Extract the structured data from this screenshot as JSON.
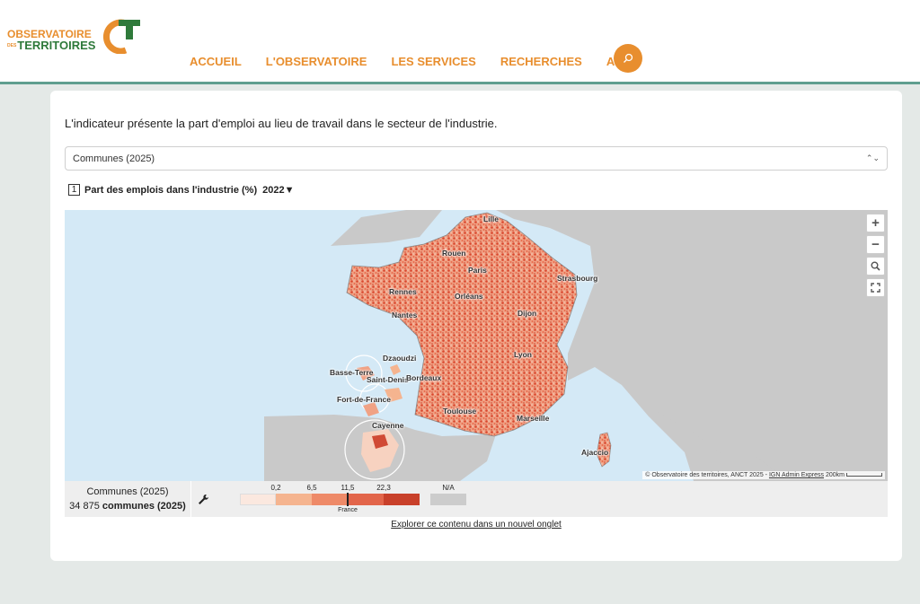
{
  "header": {
    "logo": {
      "line1": "OBSERVATOIRE",
      "small": "DES",
      "line2": "TERRITOIRES"
    },
    "nav": [
      "ACCUEIL",
      "L'OBSERVATOIRE",
      "LES SERVICES",
      "RECHERCHES",
      "AIDE"
    ],
    "search_icon": "search-icon",
    "colors": {
      "brand_orange": "#e88e2e",
      "brand_green": "#2f7a3b",
      "header_border": "#5f9e8f"
    }
  },
  "main": {
    "intro": "L'indicateur présente la part d'emploi au lieu de travail dans le secteur de l'industrie.",
    "select_value": "Communes (2025)",
    "indicator": {
      "number": "1",
      "title": "Part des emplois dans l'industrie (%)",
      "year": "2022▼"
    }
  },
  "map": {
    "labels": [
      "Lille",
      "Rouen",
      "Paris",
      "Strasbourg",
      "Rennes",
      "Orléans",
      "Nantes",
      "Dijon",
      "Dzaoudzi",
      "Basse-Terre",
      "Saint-Denis",
      "Bordeaux",
      "Lyon",
      "Fort-de-France",
      "Toulouse",
      "Marseille",
      "Cayenne",
      "Ajaccio"
    ],
    "controls": [
      "+",
      "−"
    ],
    "attribution_prefix": "© Observatoire des territoires, ANCT 2025 - ",
    "attribution_link": "IGN Admin Express",
    "scale_label": "200km"
  },
  "legend": {
    "unit_label": "Communes (2025)",
    "count": "34 875",
    "count_suffix": "communes (2025)",
    "thresholds": [
      "0,2",
      "6,5",
      "11,5",
      "22,3"
    ],
    "classes": [
      "#fbe8df",
      "#f5b48f",
      "#ee8a68",
      "#e2654a",
      "#c8402a"
    ],
    "reference_label": "France",
    "na_label": "N/A",
    "na_color": "#cccccc"
  },
  "footer_link": "Explorer ce contenu dans un nouvel onglet"
}
